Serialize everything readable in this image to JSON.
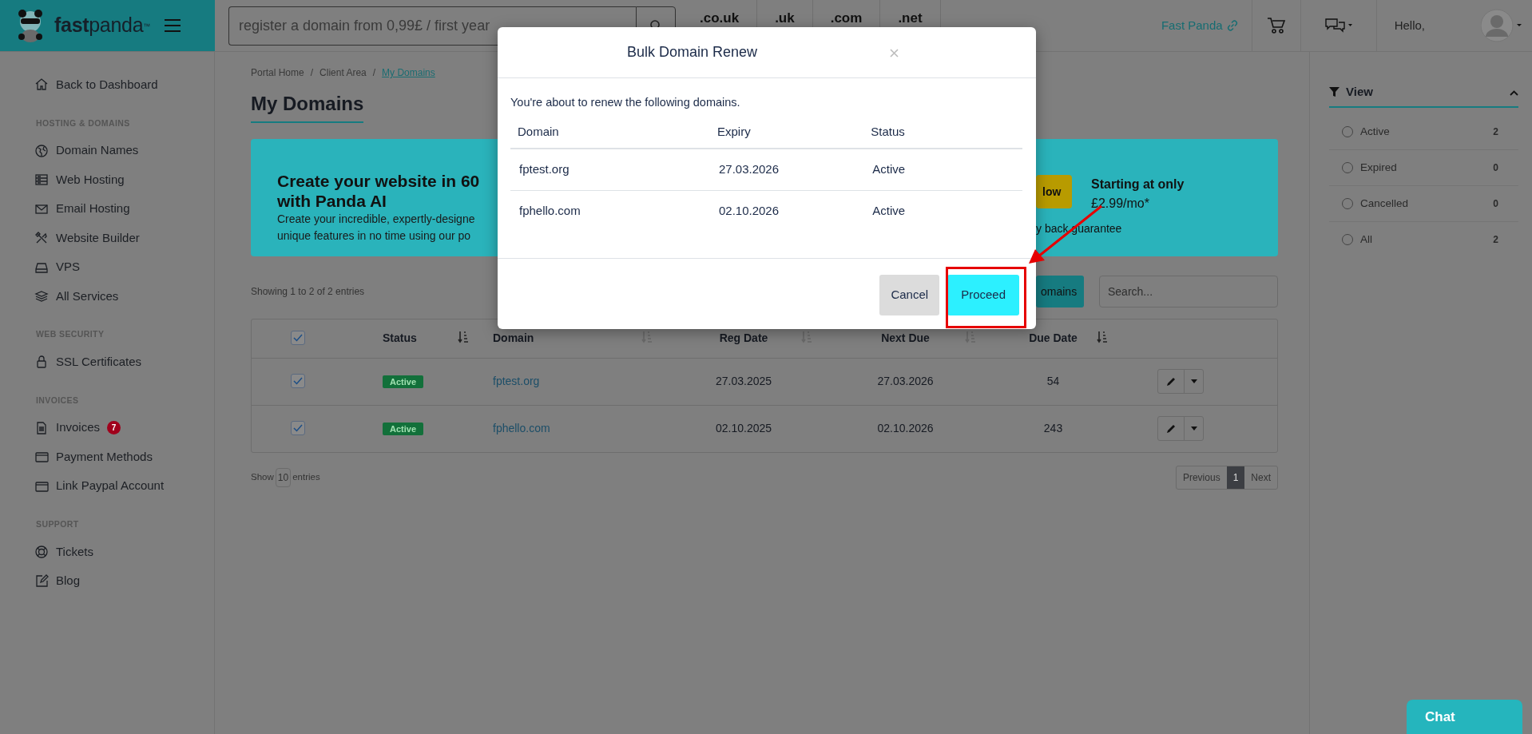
{
  "header": {
    "brand": "**fast**panda$^{™}$",
    "search": {
      "placeholder": "register a domain from 0,99£ / first year"
    },
    "tlds": [
      ".co.uk",
      ".uk",
      ".com",
      ".net"
    ],
    "site_link": "Fast Panda",
    "greeting": "Hello,"
  },
  "sidebar": {
    "items": [
      {
        "kind": "link",
        "label": "Back to Dashboard"
      },
      {
        "kind": "heading",
        "label": "HOSTING & DOMAINS"
      },
      {
        "kind": "link",
        "label": "Domain Names"
      },
      {
        "kind": "link",
        "label": "Web Hosting"
      },
      {
        "kind": "link",
        "label": "Email Hosting"
      },
      {
        "kind": "link",
        "label": "Website Builder"
      },
      {
        "kind": "link",
        "label": "VPS"
      },
      {
        "kind": "link",
        "label": "All Services"
      },
      {
        "kind": "heading",
        "label": "WEB SECURITY"
      },
      {
        "kind": "link",
        "label": "SSL Certificates"
      },
      {
        "kind": "heading",
        "label": "INVOICES"
      },
      {
        "kind": "link",
        "label": "Invoices",
        "badge": "7"
      },
      {
        "kind": "link",
        "label": "Payment Methods"
      },
      {
        "kind": "link",
        "label": "Link Paypal Account"
      },
      {
        "kind": "heading",
        "label": "SUPPORT"
      },
      {
        "kind": "link",
        "label": "Tickets"
      },
      {
        "kind": "link",
        "label": "Blog"
      }
    ]
  },
  "breadcrumb_separator": "/",
  "breadcrumb": [
    {
      "label": "Portal Home",
      "current": false
    },
    {
      "label": "Client Area",
      "current": false
    },
    {
      "label": "My Domains",
      "current": true
    }
  ],
  "page_title": "My Domains",
  "banner": {
    "title_lines": [
      "Create your website in 60",
      "with Panda AI"
    ],
    "body_lines": [
      "Create your incredible, expertly-designe",
      "unique features in no time using our po"
    ],
    "button": "low",
    "price_label": "Starting at only",
    "price": "£2.99/mo*",
    "guarantee": "y back guarantee"
  },
  "table_info": "Showing 1 to 2 of 2 entries",
  "bulk_button": "omains",
  "table_search": {
    "placeholder": "Search..."
  },
  "table": {
    "all_checked": true,
    "columns": [
      {
        "label": "Status",
        "sort_active": true
      },
      {
        "label": "Domain",
        "sort_active": false
      },
      {
        "label": "Reg Date",
        "sort_active": false
      },
      {
        "label": "Next Due",
        "sort_active": false
      },
      {
        "label": "Due Date",
        "sort_active": true
      }
    ],
    "rows": [
      {
        "checked": true,
        "status": "Active",
        "domain": "fptest.org",
        "reg_date": "27.03.2025",
        "next_due": "27.03.2026",
        "days": "54"
      },
      {
        "checked": true,
        "status": "Active",
        "domain": "fphello.com",
        "reg_date": "02.10.2025",
        "next_due": "02.10.2026",
        "days": "243"
      }
    ]
  },
  "length": {
    "prefix": "Show",
    "value": "10",
    "suffix": "entries"
  },
  "pagination": [
    {
      "label": "Previous",
      "selected": false
    },
    {
      "label": "1",
      "selected": true
    },
    {
      "label": "Next",
      "selected": false
    }
  ],
  "filter": {
    "title": "View",
    "expanded": true,
    "items": [
      {
        "label": "Active",
        "count": "2",
        "selected": false
      },
      {
        "label": "Expired",
        "count": "0",
        "selected": false
      },
      {
        "label": "Cancelled",
        "count": "0",
        "selected": false
      },
      {
        "label": "All",
        "count": "2",
        "selected": false
      }
    ]
  },
  "modal": {
    "title": "Bulk Domain Renew",
    "message": "You're about to renew the following domains.",
    "columns": [
      "Domain",
      "Expiry",
      "Status"
    ],
    "rows": [
      {
        "domain": "fptest.org",
        "expiry": "27.03.2026",
        "status": "Active"
      },
      {
        "domain": "fphello.com",
        "expiry": "02.10.2026",
        "status": "Active"
      }
    ],
    "buttons": [
      {
        "label": "Cancel",
        "kind": "secondary"
      },
      {
        "label": "Proceed",
        "kind": "primary",
        "highlighted": true
      }
    ]
  },
  "chat": "Chat"
}
